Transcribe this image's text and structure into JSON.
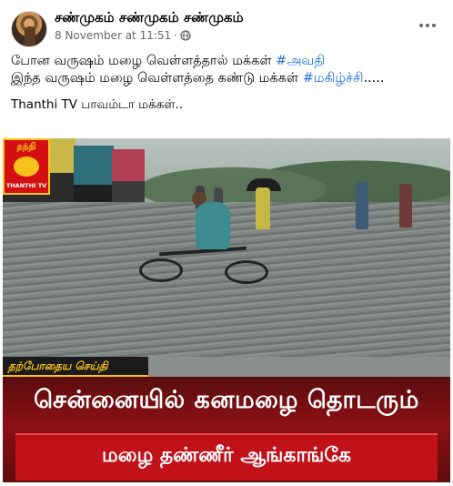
{
  "post": {
    "author": "சண்முகம் சண்முகம் சண்முகம்",
    "timestamp": "8 November at 11:51",
    "separator": "·",
    "privacy_icon": "globe-icon",
    "more_icon": "more-horizontal-icon",
    "line1_text": "போன வருஷம் மழை வெள்ளத்தால் மக்கள் ",
    "line1_hashtag": "#அவதி",
    "line2_text": "இந்த வருஷம் மழை வெள்ளத்தை கண்டு மக்கள் ",
    "line2_hashtag": "#மகிழ்ச்சி",
    "line2_suffix": ".....",
    "para2": "Thanthi TV  பாவம்டா மக்கள்.."
  },
  "photo": {
    "channel_logo_top": "தந்தி",
    "channel_logo_bottom": "THANTHI TV",
    "news_tag": "தற்போதைய செய்தி",
    "headline": "சென்னையில் கனமழை தொடரும்",
    "subline": "மழை தண்ணீர் ஆங்காங்கே"
  },
  "colors": {
    "hashtag": "#216fdb",
    "news_band": "#8a1014",
    "news_accent": "#f4c21b"
  }
}
